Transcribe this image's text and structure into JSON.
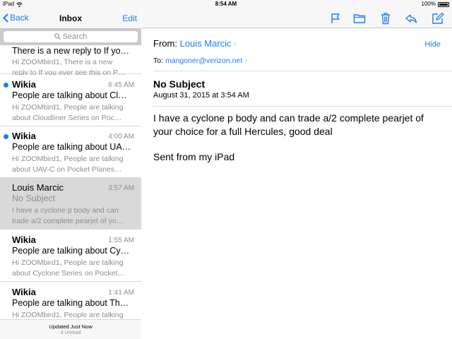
{
  "status_bar": {
    "device": "iPad",
    "time": "8:54 AM",
    "battery": "100%"
  },
  "sidebar": {
    "back_label": "Back",
    "title": "Inbox",
    "edit_label": "Edit",
    "search_placeholder": "Search",
    "messages": [
      {
        "sender": "",
        "time": "",
        "subject": "There is a new reply to If yo…",
        "preview_1": "Hi ZOOMbird1, There is a new",
        "preview_2": "reply to If you ever see this on P…",
        "unread": false
      },
      {
        "sender": "Wikia",
        "time": "6:45 AM",
        "subject": "People are talking about Cl…",
        "preview_1": "Hi ZOOMbird1, People are talking",
        "preview_2": "about Cloudliner Series on Poc…",
        "unread": true
      },
      {
        "sender": "Wikia",
        "time": "4:00 AM",
        "subject": "People are talking about UA…",
        "preview_1": "Hi ZOOMbird1, People are talking",
        "preview_2": "about UAV-C on Pocket Planes…",
        "unread": true
      },
      {
        "sender": "Louis Marcic",
        "time": "3:57 AM",
        "subject": "No Subject",
        "preview_1": "I have a cyclone p body and can",
        "preview_2": "trade a/2 complete pearjet of yo…",
        "unread": false,
        "selected": true
      },
      {
        "sender": "Wikia",
        "time": "1:55 AM",
        "subject": "People are talking about Cy…",
        "preview_1": "Hi ZOOMbird1, People are talking",
        "preview_2": "about Cyclone Series on Pocket…",
        "unread": false
      },
      {
        "sender": "Wikia",
        "time": "1:41 AM",
        "subject": "People are talking about Th…",
        "preview_1": "Hi ZOOMbird1, People are talking",
        "preview_2": "",
        "unread": false
      }
    ],
    "footer": {
      "updated": "Updated Just Now",
      "unread_count": "4 Unread"
    }
  },
  "toolbar": {
    "icons": [
      "flag-icon",
      "folder-icon",
      "trash-icon",
      "reply-icon",
      "compose-icon"
    ],
    "accent": "#157efb"
  },
  "message": {
    "from_label": "From:",
    "from_name": "Louis Marcic",
    "hide_label": "Hide",
    "to_label": "To:",
    "to_address": "mangoner@verizon.net",
    "subject": "No Subject",
    "date": "August 31, 2015 at 3:54 AM",
    "body_1": "I have a cyclone p body and can trade a/2 complete pearjet of your choice for a full Hercules, good deal",
    "body_2": "Sent from my iPad"
  }
}
